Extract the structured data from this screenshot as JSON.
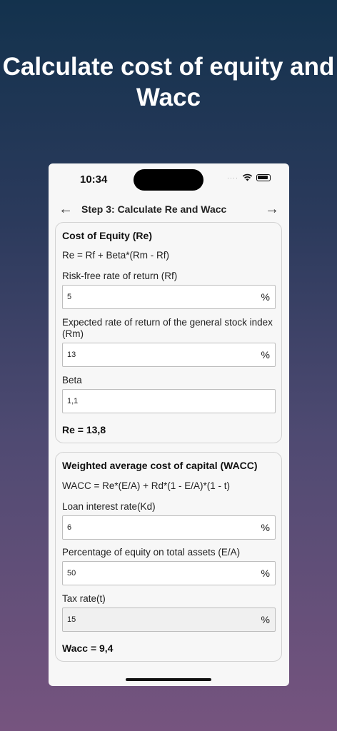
{
  "headline": "Calculate cost of equity and Wacc",
  "status": {
    "time": "10:34",
    "dots": "····",
    "wifi_icon": "wifi-icon",
    "battery_icon": "battery-icon"
  },
  "nav": {
    "title": "Step 3: Calculate Re and Wacc",
    "back_icon": "arrow-left-icon",
    "forward_icon": "arrow-right-icon"
  },
  "equity": {
    "title": "Cost of Equity (Re)",
    "formula": "Re = Rf + Beta*(Rm - Rf)",
    "rf": {
      "label": "Risk-free rate of return (Rf)",
      "value": "5",
      "unit": "%"
    },
    "rm": {
      "label": "Expected rate of return of the general stock index (Rm)",
      "value": "13",
      "unit": "%"
    },
    "beta": {
      "label": "Beta",
      "value": "1,1"
    },
    "result": "Re = 13,8"
  },
  "wacc": {
    "title": "Weighted average cost of capital (WACC)",
    "formula": "WACC = Re*(E/A) + Rd*(1 - E/A)*(1 - t)",
    "kd": {
      "label": "Loan interest rate(Kd)",
      "value": "6",
      "unit": "%"
    },
    "ea": {
      "label": "Percentage of equity on total assets (E/A)",
      "value": "50",
      "unit": "%"
    },
    "tax": {
      "label": "Tax rate(t)",
      "value": "15",
      "unit": "%"
    },
    "result": "Wacc = 9,4"
  }
}
